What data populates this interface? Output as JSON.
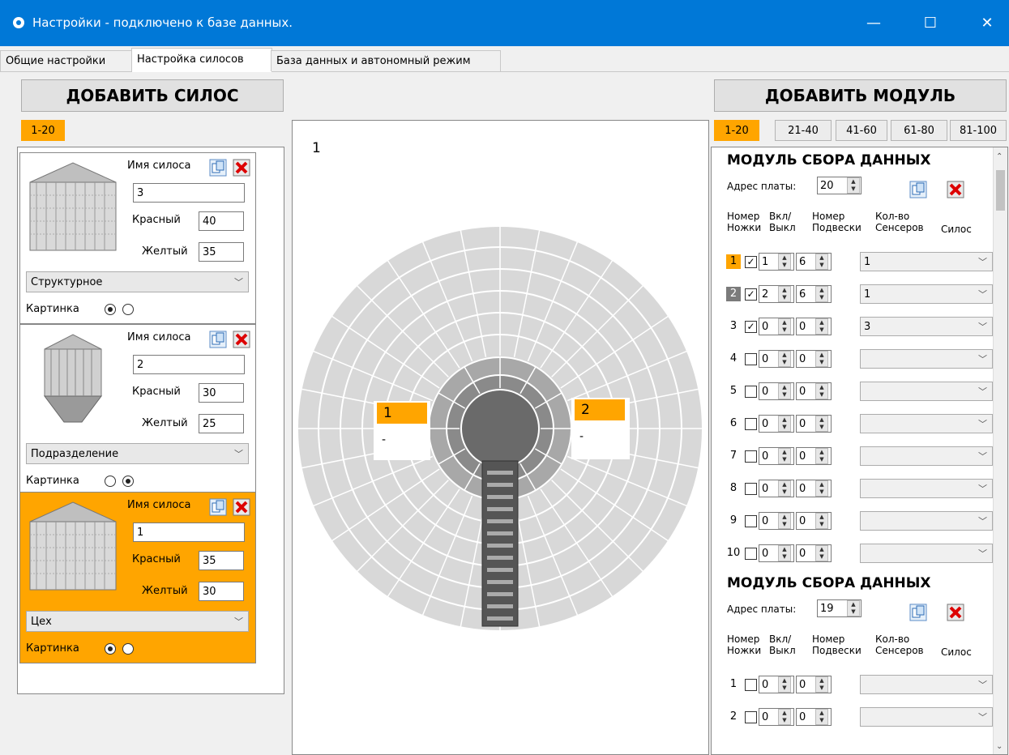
{
  "window": {
    "title": "Настройки - подключено к базе данных.",
    "min": "—",
    "max": "☐",
    "close": "✕"
  },
  "tabs": [
    {
      "label": "Общие настройки"
    },
    {
      "label": "Настройка силосов"
    },
    {
      "label": "База данных и автономный режим"
    }
  ],
  "left": {
    "add_silo_label": "ДОБАВИТЬ СИЛОС",
    "page_label": "1-20",
    "name_label": "Имя силоса",
    "red_label": "Красный",
    "yellow_label": "Желтый",
    "picture_label": "Картинка",
    "silos": [
      {
        "name": "3",
        "red": "40",
        "yellow": "35",
        "type": "Структурное",
        "picture": 1,
        "selected": false
      },
      {
        "name": "2",
        "red": "30",
        "yellow": "25",
        "type": "Подразделение",
        "picture": 2,
        "selected": false
      },
      {
        "name": "1",
        "red": "35",
        "yellow": "30",
        "type": "Цех",
        "picture": 1,
        "selected": true
      }
    ]
  },
  "center": {
    "silo_number": "1",
    "sensors": [
      {
        "label": "1",
        "value": "-"
      },
      {
        "label": "2",
        "value": "-"
      }
    ],
    "colors": {
      "outer": "#d8d8d8",
      "mid": "#a8a8a8",
      "core": "#6a6a6a",
      "bridge": "#555555",
      "highlight": "#ffa500"
    }
  },
  "right": {
    "add_module_label": "ДОБАВИТЬ МОДУЛЬ",
    "pages": [
      "1-20",
      "21-40",
      "41-60",
      "61-80",
      "81-100"
    ],
    "module_title": "МОДУЛЬ СБОРА ДАННЫХ",
    "address_label": "Адрес платы:",
    "headers": {
      "h1a": "Номер",
      "h1b": "Ножки",
      "h2a": "Вкл/",
      "h2b": "Выкл",
      "h3a": "Номер",
      "h3b": "Подвески",
      "h4a": "Кол-во",
      "h4b": "Сенсеров",
      "h5": "Силос"
    },
    "modules": [
      {
        "address": "20",
        "rows": [
          {
            "n": "1",
            "checked": true,
            "susp": "1",
            "count": "6",
            "silo": "1",
            "mark": "orange"
          },
          {
            "n": "2",
            "checked": true,
            "susp": "2",
            "count": "6",
            "silo": "1",
            "mark": "gray"
          },
          {
            "n": "3",
            "checked": true,
            "susp": "0",
            "count": "0",
            "silo": "3",
            "mark": ""
          },
          {
            "n": "4",
            "checked": false,
            "susp": "0",
            "count": "0",
            "silo": "",
            "mark": ""
          },
          {
            "n": "5",
            "checked": false,
            "susp": "0",
            "count": "0",
            "silo": "",
            "mark": ""
          },
          {
            "n": "6",
            "checked": false,
            "susp": "0",
            "count": "0",
            "silo": "",
            "mark": ""
          },
          {
            "n": "7",
            "checked": false,
            "susp": "0",
            "count": "0",
            "silo": "",
            "mark": ""
          },
          {
            "n": "8",
            "checked": false,
            "susp": "0",
            "count": "0",
            "silo": "",
            "mark": ""
          },
          {
            "n": "9",
            "checked": false,
            "susp": "0",
            "count": "0",
            "silo": "",
            "mark": ""
          },
          {
            "n": "10",
            "checked": false,
            "susp": "0",
            "count": "0",
            "silo": "",
            "mark": ""
          }
        ]
      },
      {
        "address": "19",
        "rows": [
          {
            "n": "1",
            "checked": false,
            "susp": "0",
            "count": "0",
            "silo": "",
            "mark": ""
          },
          {
            "n": "2",
            "checked": false,
            "susp": "0",
            "count": "0",
            "silo": "",
            "mark": ""
          }
        ]
      }
    ]
  }
}
